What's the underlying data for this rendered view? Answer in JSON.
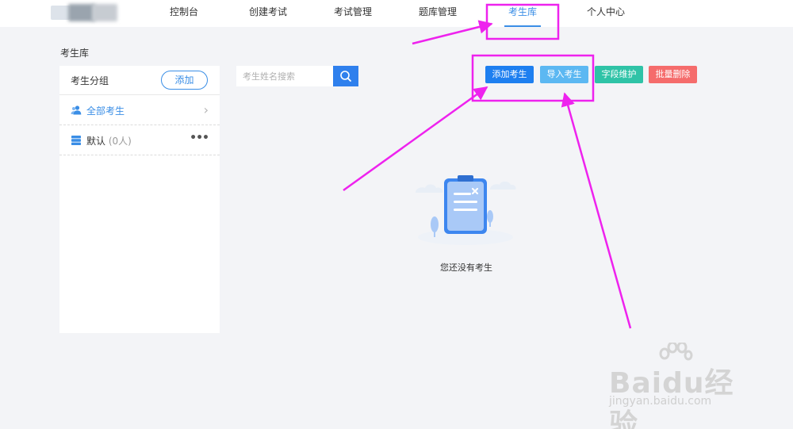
{
  "nav": {
    "items": [
      {
        "label": "控制台",
        "active": false
      },
      {
        "label": "创建考试",
        "active": false
      },
      {
        "label": "考试管理",
        "active": false
      },
      {
        "label": "题库管理",
        "active": false
      },
      {
        "label": "考生库",
        "active": true
      },
      {
        "label": "个人中心",
        "active": false
      }
    ]
  },
  "page": {
    "title": "考生库"
  },
  "groups": {
    "header": "考生分组",
    "add_label": "添加",
    "items": [
      {
        "label": "全部考生",
        "icon": "users-icon"
      },
      {
        "label": "默认",
        "count": "(0人)",
        "icon": "database-icon"
      }
    ]
  },
  "search": {
    "placeholder": "考生姓名搜索"
  },
  "actions": {
    "add": "添加考生",
    "import": "导入考生",
    "fields": "字段维护",
    "batch_delete": "批量删除"
  },
  "empty": {
    "text": "您还没有考生"
  },
  "watermark": {
    "brand": "Baidu经验",
    "url": "jingyan.baidu.com"
  },
  "colors": {
    "primary": "#3a8ee6",
    "add_btn": "#1e7ff0",
    "import_btn": "#5cb8f2",
    "fields_btn": "#2fc3a7",
    "delete_btn": "#f56c6c",
    "annotation": "#ee22ee"
  }
}
